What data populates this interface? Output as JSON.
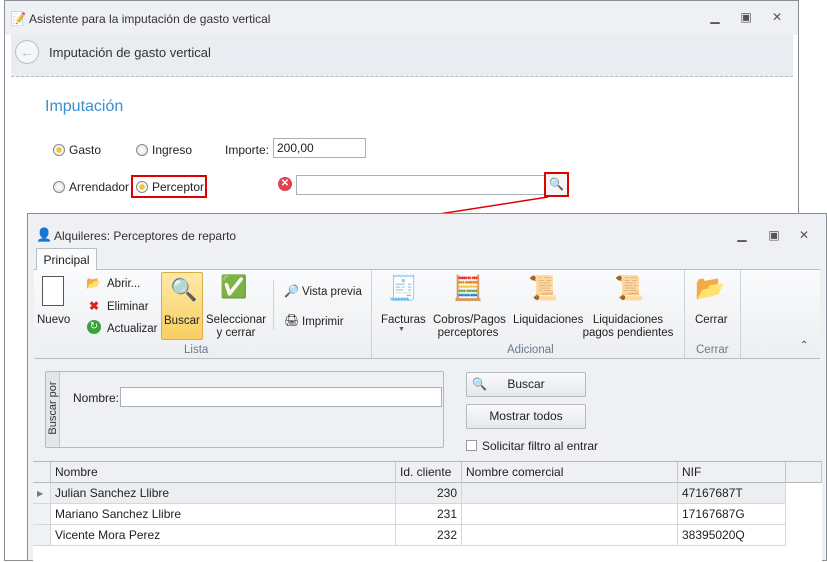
{
  "main_window": {
    "title": "Asistente para la imputación de gasto vertical",
    "header": "Imputación de gasto vertical",
    "section_title": "Imputación",
    "radios": [
      {
        "label": "Gasto",
        "selected": true
      },
      {
        "label": "Ingreso",
        "selected": false
      },
      {
        "label": "Arrendador",
        "selected": false
      },
      {
        "label": "Perceptor",
        "selected": true
      }
    ],
    "importe_label": "Importe:",
    "importe_value": "200,00",
    "perceptor_value": ""
  },
  "dialog": {
    "title": "Alquileres: Perceptores de reparto",
    "tab": "Principal",
    "ribbon": {
      "nuevo": "Nuevo",
      "abrir": "Abrir...",
      "eliminar": "Eliminar",
      "actualizar": "Actualizar",
      "buscar": "Buscar",
      "seleccionar": [
        "Seleccionar",
        "y cerrar"
      ],
      "vista_previa": "Vista previa",
      "imprimir": "Imprimir",
      "group_lista": "Lista",
      "facturas": "Facturas",
      "cobros": [
        "Cobros/Pagos",
        "perceptores"
      ],
      "liquidaciones": "Liquidaciones",
      "liq_pend": [
        "Liquidaciones",
        "pagos pendientes"
      ],
      "group_adicional": "Adicional",
      "cerrar": "Cerrar",
      "group_cerrar": "Cerrar"
    },
    "search": {
      "group": "Buscar por",
      "nombre_label": "Nombre:",
      "nombre_value": "",
      "buscar": "Buscar",
      "mostrar_todos": "Mostrar todos",
      "filtro_label": "Solicitar filtro al entrar",
      "filtro_checked": false
    },
    "grid": {
      "columns": [
        "Nombre",
        "Id. cliente",
        "Nombre comercial",
        "NIF"
      ],
      "rows": [
        [
          "Julian Sanchez Llibre",
          "230",
          "",
          "47167687T"
        ],
        [
          "Mariano Sanchez Llibre",
          "231",
          "",
          "17167687G"
        ],
        [
          "Vicente Mora Perez",
          "232",
          "",
          "38395020Q"
        ]
      ]
    }
  },
  "colors": {
    "accent": "#3a8fd0",
    "highlight": "#e00000",
    "selected_button": "#fbd97a"
  }
}
